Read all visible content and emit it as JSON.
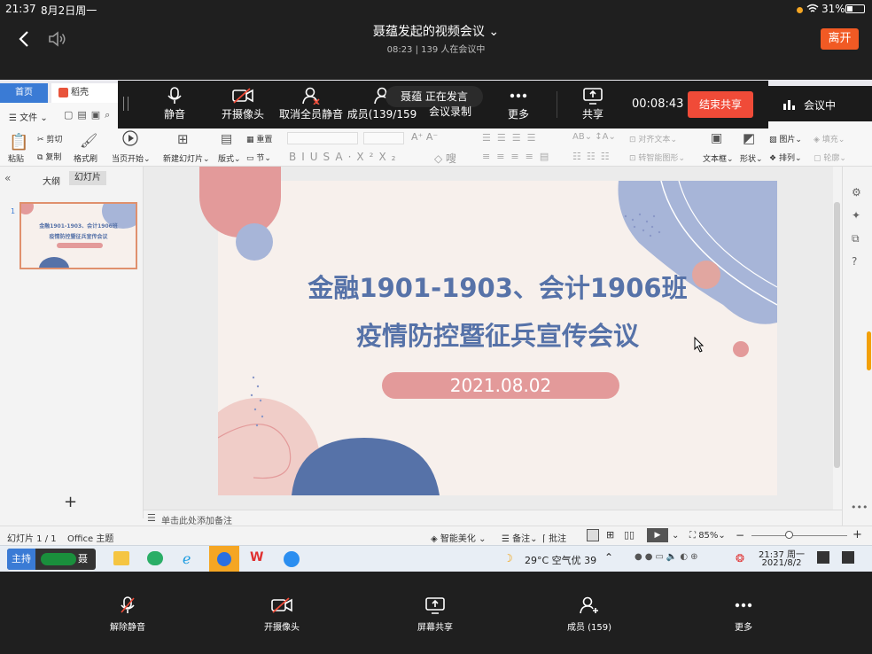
{
  "status": {
    "time": "21:37",
    "date": "8月2日周一",
    "battery": "31%"
  },
  "meeting": {
    "title": "聂蕴发起的视频会议",
    "subtitle": "08:23 | 139 人在会议中",
    "leave": "离开"
  },
  "tabs": {
    "home": "首页",
    "daoke": "稻壳"
  },
  "share_toolbar": {
    "mute": "静音",
    "camera": "开摄像头",
    "unmute_all": "取消全员静音",
    "members": "成员(139/159",
    "speaker": "聂蕴 正在发言",
    "record": "会议录制",
    "more": "更多",
    "share": "共享",
    "timer": "00:08:43",
    "end_share": "结束共享",
    "in_meeting": "会议中"
  },
  "ribbon": {
    "file": "文件",
    "paste": "粘贴",
    "cut": "剪切",
    "copy": "复制",
    "format_painter": "格式刷",
    "from_current": "当页开始",
    "new_slide": "新建幻灯片",
    "layout": "版式",
    "section": "节",
    "reset": "重置",
    "align_text": "对齐文本",
    "smart_graphic": "转智能图形",
    "textbox": "文本框",
    "shape": "形状",
    "picture": "图片",
    "arrange": "排列",
    "fill": "填充",
    "outline": "轮廓"
  },
  "left_panel": {
    "outline_tab": "大纲",
    "slides_tab": "幻灯片",
    "slide_number": "1",
    "add": "+"
  },
  "slide": {
    "title_line1": "金融1901-1903、会计1906班",
    "title_line2": "疫情防控暨征兵宣传会议",
    "date": "2021.08.02",
    "thumb_line1": "金融1901-1903、会计1906班",
    "thumb_line2": "疫情防控暨征兵宣传会议"
  },
  "notes": {
    "placeholder": "单击此处添加备注"
  },
  "statusrow": {
    "slide_count": "幻灯片 1 / 1",
    "theme": "Office 主题",
    "beautify": "智能美化",
    "notes": "备注",
    "comment": "批注",
    "zoom": "85%"
  },
  "taskbar": {
    "host_label": "主持",
    "host_name": "聂蕴",
    "weather": "29°C  空气优 39",
    "clock_time": "21:37 周一",
    "clock_date": "2021/8/2"
  },
  "bottom": {
    "unmute": "解除静音",
    "camera": "开摄像头",
    "screen_share": "屏幕共享",
    "members": "成员 (159)",
    "more": "更多"
  },
  "colors": {
    "accent_orange": "#f15a24",
    "slide_blue": "#5672a8",
    "slide_pink": "#e39a9a",
    "end_share_red": "#f04b38"
  }
}
